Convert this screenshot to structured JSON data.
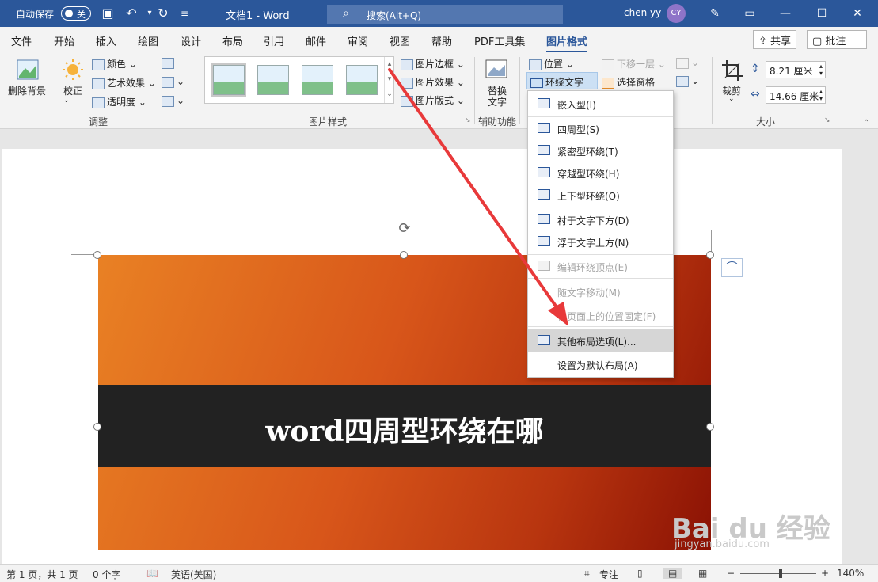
{
  "titlebar": {
    "autosave_label": "自动保存",
    "autosave_toggle": "关",
    "doc_title": "文档1  -  Word",
    "search_placeholder": "搜索(Alt+Q)",
    "user_name": "chen yy",
    "avatar_initials": "CY"
  },
  "tabs": [
    "文件",
    "开始",
    "插入",
    "绘图",
    "设计",
    "布局",
    "引用",
    "邮件",
    "审阅",
    "视图",
    "帮助",
    "PDF工具集",
    "图片格式"
  ],
  "active_tab": "图片格式",
  "share_label": "共享",
  "comment_label": "批注",
  "ribbon": {
    "remove_bg": "删除背景",
    "correct": "校正",
    "color": "颜色",
    "artistic": "艺术效果",
    "transparency": "透明度",
    "group_adjust": "调整",
    "picture_border": "图片边框",
    "picture_effects": "图片效果",
    "picture_layout": "图片版式",
    "group_styles": "图片样式",
    "alt_text_1": "替换",
    "alt_text_2": "文字",
    "group_accessibility": "辅助功能",
    "position": "位置",
    "wrap_text": "环绕文字",
    "send_backward": "下移一层",
    "selection_pane": "选择窗格",
    "crop": "裁剪",
    "height": "8.21 厘米",
    "width": "14.66 厘米",
    "group_size": "大小"
  },
  "wrap_menu": [
    {
      "label": "嵌入型(I)",
      "enabled": true
    },
    {
      "label": "四周型(S)",
      "enabled": true
    },
    {
      "label": "紧密型环绕(T)",
      "enabled": true
    },
    {
      "label": "穿越型环绕(H)",
      "enabled": true
    },
    {
      "label": "上下型环绕(O)",
      "enabled": true
    },
    {
      "label": "衬于文字下方(D)",
      "enabled": true
    },
    {
      "label": "浮于文字上方(N)",
      "enabled": true
    },
    {
      "label": "编辑环绕顶点(E)",
      "enabled": false
    },
    {
      "label": "随文字移动(M)",
      "enabled": false
    },
    {
      "label": "在页面上的位置固定(F)",
      "enabled": false
    },
    {
      "label": "其他布局选项(L)...",
      "enabled": true
    },
    {
      "label": "设置为默认布局(A)",
      "enabled": true
    }
  ],
  "image_text": "word四周型环绕在哪",
  "status": {
    "page": "第 1 页，共 1 页",
    "words": "0 个字",
    "language": "英语(美国)",
    "focus": "专注",
    "zoom": "140%"
  },
  "watermark": {
    "brand": "Bai du 经验",
    "url": "jingyan.baidu.com"
  },
  "colors": {
    "title_bar": "#2b579a",
    "arrow": "#e8393a",
    "image_gradient_start": "#e98124",
    "image_gradient_end": "#8b1204"
  }
}
